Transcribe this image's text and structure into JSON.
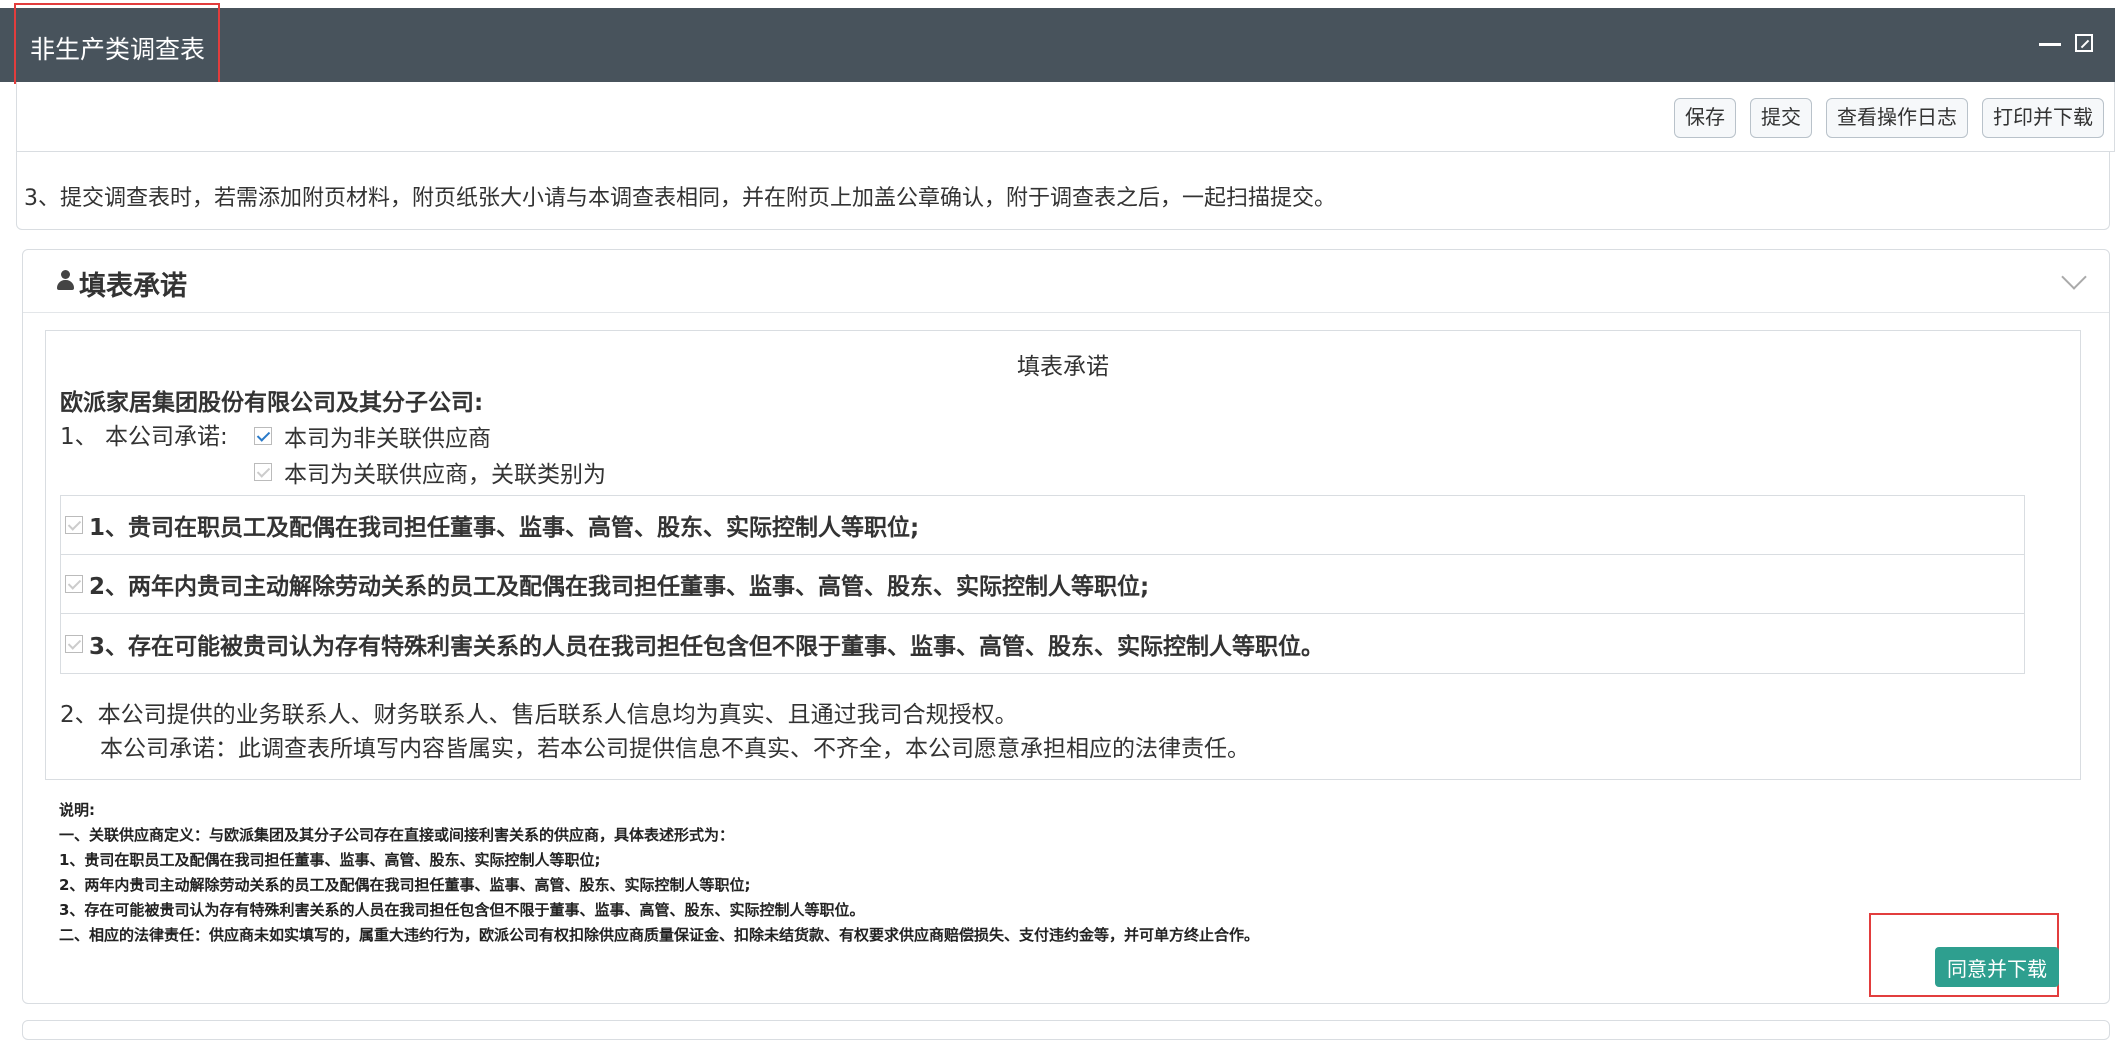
{
  "window": {
    "title": "非生产类调查表"
  },
  "toolbar": {
    "buttons": [
      "保存",
      "提交",
      "查看操作日志",
      "打印并下载"
    ]
  },
  "notes": {
    "item3": "3、提交调查表时，若需添加附页材料，附页纸张大小请与本调查表相同，并在附页上加盖公章确认，附于调查表之后，一起扫描提交。"
  },
  "pledge": {
    "section_title": "填表承诺",
    "box_title": "填表承诺",
    "company": "欧派家居集团股份有限公司及其分子公司:",
    "promise_label": "1、 本公司承诺:",
    "options": [
      {
        "label": "本司为非关联供应商",
        "checked": true
      },
      {
        "label": "本司为关联供应商，关联类别为",
        "checked": false
      }
    ],
    "relations": [
      "1、贵司在职员工及配偶在我司担任董事、监事、高管、股东、实际控制人等职位;",
      "2、两年内贵司主动解除劳动关系的员工及配偶在我司担任董事、监事、高管、股东、实际控制人等职位;",
      "3、存在可能被贵司认为存有特殊利害关系的人员在我司担任包含但不限于董事、监事、高管、股东、实际控制人等职位。"
    ],
    "item2": "2、本公司提供的业务联系人、财务联系人、售后联系人信息均为真实、且通过我司合规授权。",
    "item2_commit": "本公司承诺：此调查表所填写内容皆属实，若本公司提供信息不真实、不齐全，本公司愿意承担相应的法律责任。",
    "remarks": [
      "说明:",
      "一、关联供应商定义：与欧派集团及其分子公司存在直接或间接利害关系的供应商，具体表述形式为：",
      "1、贵司在职员工及配偶在我司担任董事、监事、高管、股东、实际控制人等职位;",
      "2、两年内贵司主动解除劳动关系的员工及配偶在我司担任董事、监事、高管、股东、实际控制人等职位;",
      "3、存在可能被贵司认为存有特殊利害关系的人员在我司担任包含但不限于董事、监事、高管、股东、实际控制人等职位。",
      "二、相应的法律责任：供应商未如实填写的，属重大违约行为，欧派公司有权扣除供应商质量保证金、扣除未结货款、有权要求供应商赔偿损失、支付违约金等，并可单方终止合作。"
    ],
    "agree_button": "同意并下载"
  },
  "colors": {
    "titlebar": "#48535c",
    "highlight": "#e23d3d",
    "agree": "#2e9f8f",
    "check": "#2a7ac9"
  }
}
